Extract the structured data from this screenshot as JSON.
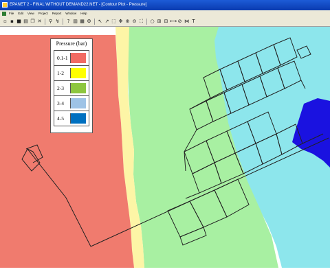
{
  "window": {
    "title": "EPANET 2 - FINAL WITHOUT DEMAND22.NET - [Contour Plot - Pressure]",
    "accent": "#1d5bd6"
  },
  "menubar": {
    "items": [
      "File",
      "Edit",
      "View",
      "Project",
      "Report",
      "Window",
      "Help"
    ]
  },
  "toolbar": {
    "buttons": [
      {
        "icon": "new-file-icon",
        "glyph": "▫"
      },
      {
        "icon": "open-folder-icon",
        "glyph": "▪"
      },
      {
        "icon": "save-icon",
        "glyph": "■"
      },
      {
        "icon": "print-icon",
        "glyph": "▤"
      },
      {
        "icon": "copy-icon",
        "glyph": "❐"
      },
      {
        "icon": "delete-icon",
        "glyph": "✕"
      },
      {
        "icon": "find-icon",
        "glyph": "⚲"
      },
      {
        "icon": "run-icon",
        "glyph": "↯"
      },
      {
        "icon": "query-icon",
        "glyph": "?"
      },
      {
        "icon": "graph-icon",
        "glyph": "▥"
      },
      {
        "icon": "table-icon",
        "glyph": "▦"
      },
      {
        "icon": "options-icon",
        "glyph": "⚙"
      },
      {
        "icon": "select-object-icon",
        "glyph": "↖"
      },
      {
        "icon": "select-vertex-icon",
        "glyph": "↗"
      },
      {
        "icon": "select-region-icon",
        "glyph": "⬚"
      },
      {
        "icon": "pan-icon",
        "glyph": "✥"
      },
      {
        "icon": "zoom-in-icon",
        "glyph": "⊕"
      },
      {
        "icon": "zoom-out-icon",
        "glyph": "⊖"
      },
      {
        "icon": "full-extent-icon",
        "glyph": "⛶"
      },
      {
        "icon": "add-junction-icon",
        "glyph": "○"
      },
      {
        "icon": "add-reservoir-icon",
        "glyph": "⊞"
      },
      {
        "icon": "add-tank-icon",
        "glyph": "⊟"
      },
      {
        "icon": "add-pipe-icon",
        "glyph": "⟷"
      },
      {
        "icon": "add-pump-icon",
        "glyph": "⊘"
      },
      {
        "icon": "add-valve-icon",
        "glyph": "⋈"
      },
      {
        "icon": "add-label-icon",
        "glyph": "T"
      }
    ]
  },
  "legend": {
    "title": "Pressure (bar)",
    "ranges": [
      {
        "label": "0.1-1",
        "color": "#f26b63"
      },
      {
        "label": "1-2",
        "color": "#ffff00"
      },
      {
        "label": "2-3",
        "color": "#8dc63f"
      },
      {
        "label": "3-4",
        "color": "#9ec3e6"
      },
      {
        "label": "4-5",
        "color": "#0070c0"
      }
    ]
  },
  "contour_colors": {
    "zone_red": "#f07b6e",
    "zone_yellow": "#fdf5a6",
    "zone_green": "#a8f0a2",
    "zone_cyan": "#8de6ec",
    "zone_blue": "#1a12e0"
  }
}
